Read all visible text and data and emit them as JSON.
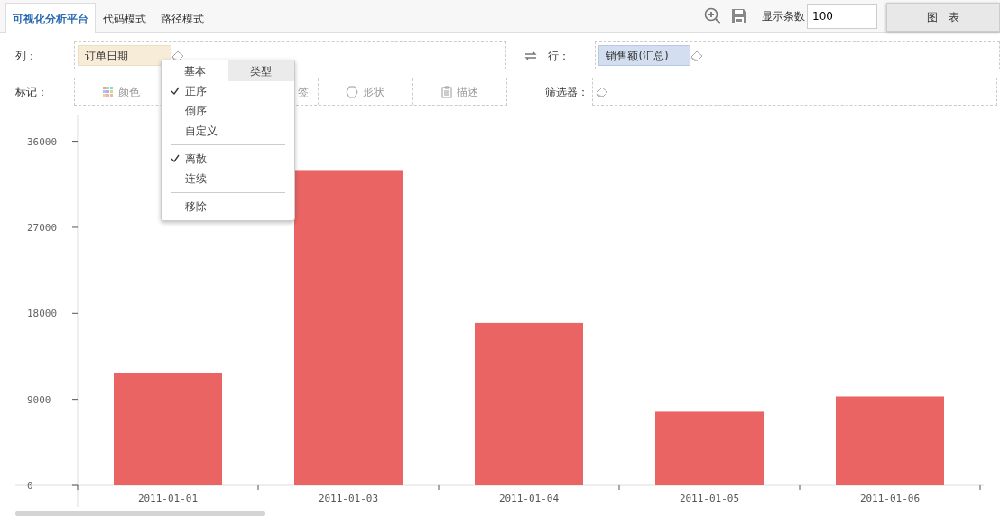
{
  "tabs": [
    {
      "label": "可视化分析平台",
      "selected": true
    },
    {
      "label": "代码模式",
      "selected": false
    },
    {
      "label": "路径模式",
      "selected": false
    }
  ],
  "toolbar": {
    "count_label": "显示条数",
    "count_value": "100",
    "chart_button": "图　表"
  },
  "shelves": {
    "columns_label": "列：",
    "columns_pill": "订单日期",
    "rows_label": "行：",
    "rows_pill": "销售额(汇总)",
    "marks_label": "标记：",
    "filter_label": "筛选器：",
    "marks": [
      {
        "kind": "color",
        "label": "颜色"
      },
      {
        "kind": "none",
        "label": "签"
      },
      {
        "kind": "shape",
        "label": "形状"
      },
      {
        "kind": "detail",
        "label": "描述"
      }
    ]
  },
  "menu": {
    "tabs": [
      {
        "label": "基本",
        "selected": false
      },
      {
        "label": "类型",
        "selected": true
      }
    ],
    "groups": [
      [
        {
          "label": "正序",
          "checked": true
        },
        {
          "label": "倒序",
          "checked": false
        },
        {
          "label": "自定义",
          "checked": false
        }
      ],
      [
        {
          "label": "离散",
          "checked": true
        },
        {
          "label": "连续",
          "checked": false
        }
      ],
      [
        {
          "label": "移除",
          "checked": false
        }
      ]
    ]
  },
  "chart_data": {
    "type": "bar",
    "categories": [
      "2011-01-01",
      "2011-01-03",
      "2011-01-04",
      "2011-01-05",
      "2011-01-06"
    ],
    "series": [
      {
        "color": "#eb6464",
        "values": [
          11800,
          32900,
          17000,
          7700,
          9300
        ]
      }
    ],
    "ylim": [
      0,
      38700
    ],
    "yticks": [
      0,
      9000,
      18000,
      27000,
      36000
    ]
  }
}
